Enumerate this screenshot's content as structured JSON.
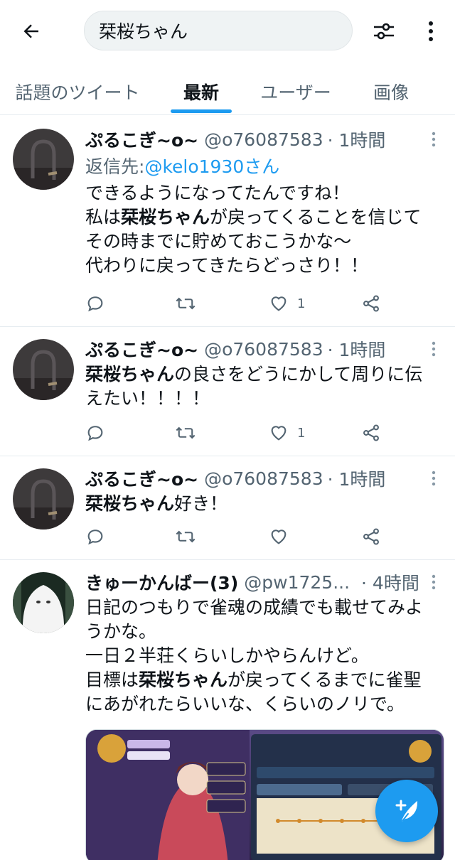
{
  "header": {
    "search_query": "栞桜ちゃん"
  },
  "tabs": [
    {
      "label": "話題のツイート"
    },
    {
      "label": "最新"
    },
    {
      "label": "ユーザー"
    },
    {
      "label": "画像"
    }
  ],
  "tweets": [
    {
      "name": "ぷるこぎ~o~",
      "handle": "@o76087583",
      "time": "· 1時間",
      "reply_prefix": "返信先: ",
      "reply_to": "@kelo1930さん",
      "text_lines": [
        [
          "できるようになってたんですね！"
        ],
        [
          "私は",
          "栞桜ちゃん",
          "が戻ってくることを信じて"
        ],
        [
          "その時までに貯めておこうかな～"
        ],
        [
          "代わりに戻ってきたらどっさり！！"
        ]
      ],
      "likes": "1"
    },
    {
      "name": "ぷるこぎ~o~",
      "handle": "@o76087583",
      "time": "· 1時間",
      "text_lines": [
        [
          "",
          "栞桜ちゃん",
          "の良さをどうにかして周りに伝"
        ],
        [
          "えたい！！！！"
        ]
      ],
      "likes": "1"
    },
    {
      "name": "ぷるこぎ~o~",
      "handle": "@o76087583",
      "time": "· 1時間",
      "text_lines": [
        [
          "",
          "栞桜ちゃん",
          "好き！"
        ]
      ],
      "likes": ""
    },
    {
      "name": "きゅーかんばー(3)",
      "handle": "@pw1725...",
      "time": "· 4時間",
      "text_lines": [
        [
          "日記のつもりで雀魂の成績でも載せてみよ"
        ],
        [
          "うかな。"
        ],
        [
          "一日２半荘くらいしかやらんけど。"
        ],
        [
          "目標は",
          "栞桜ちゃん",
          "が戻ってくるまでに雀聖"
        ],
        [
          "にあがれたらいいな、くらいのノリで。"
        ]
      ],
      "likes": ""
    }
  ],
  "colors": {
    "accent": "#1d9bf0",
    "text": "#0f1419",
    "muted": "#536471",
    "divider": "#e6ecf0"
  },
  "icons": {
    "back": "arrow-left-icon",
    "filter": "sliders-icon",
    "more": "vertical-ellipsis-icon",
    "reply": "speech-bubble-icon",
    "retweet": "retweet-icon",
    "like": "heart-icon",
    "share": "share-icon",
    "compose": "feather-plus-icon"
  }
}
